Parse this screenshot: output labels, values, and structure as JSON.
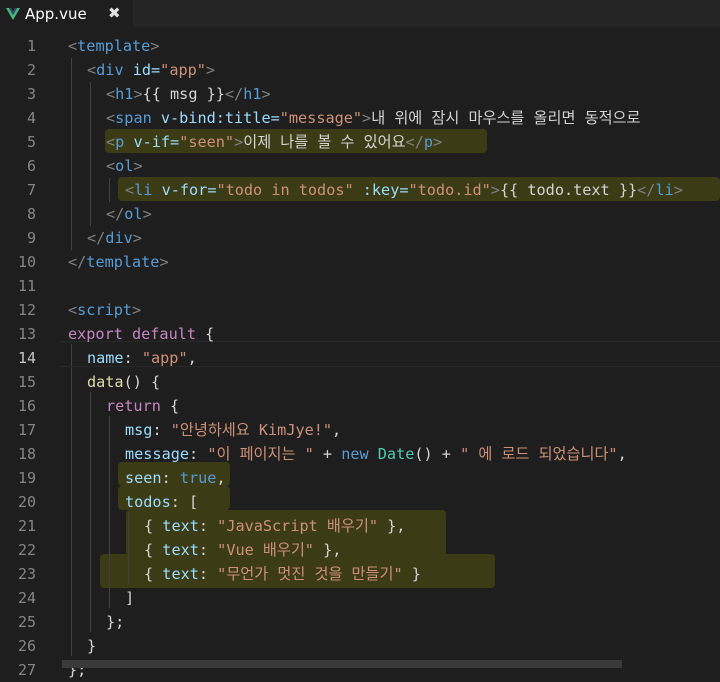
{
  "tab": {
    "title": "App.vue",
    "close_glyph": "✖",
    "icon": "vue-logo-icon"
  },
  "colors": {
    "tag": "#569cd6",
    "attr": "#9cdcfe",
    "string": "#ce9178",
    "keyword": "#c586c0",
    "function": "#dcdcaa",
    "class": "#4ec9b0",
    "highlight": "#3b3b15"
  },
  "editor": {
    "active_line": 14,
    "lines": [
      {
        "num": "1",
        "tokens": {
          "a": "<",
          "b": "template",
          "c": ">"
        }
      },
      {
        "num": "2",
        "tokens": {
          "a": "<",
          "b": "div",
          "c": " id=",
          "d": "\"app\"",
          "e": ">"
        }
      },
      {
        "num": "3",
        "tokens": {
          "a": "<",
          "b": "h1",
          "c": ">",
          "d": "{{ msg }}",
          "e": "</",
          "f": "h1",
          "g": ">"
        }
      },
      {
        "num": "4",
        "tokens": {
          "a": "<",
          "b": "span",
          "c": " v-bind:title=",
          "d": "\"message\"",
          "e": ">",
          "f": "내 위에 잠시 마우스를 올리면 동적으로"
        }
      },
      {
        "num": "5",
        "tokens": {
          "a": "<",
          "b": "p",
          "c": " v-if=",
          "d": "\"seen\"",
          "e": ">",
          "f": "이제 나를 볼 수 있어요",
          "g": "</",
          "h": "p",
          "i": ">"
        }
      },
      {
        "num": "6",
        "tokens": {
          "a": "<",
          "b": "ol",
          "c": ">"
        }
      },
      {
        "num": "7",
        "tokens": {
          "a": "<",
          "b": "li",
          "c": " v-for=",
          "d": "\"todo in todos\"",
          "e": " :key=",
          "f": "\"todo.id\"",
          "g": ">",
          "h": "{{ todo.text }}",
          "i": "</",
          "j": "li",
          "k": ">"
        }
      },
      {
        "num": "8",
        "tokens": {
          "a": "</",
          "b": "ol",
          "c": ">"
        }
      },
      {
        "num": "9",
        "tokens": {
          "a": "</",
          "b": "div",
          "c": ">"
        }
      },
      {
        "num": "10",
        "tokens": {
          "a": "</",
          "b": "template",
          "c": ">"
        }
      },
      {
        "num": "11",
        "tokens": {}
      },
      {
        "num": "12",
        "tokens": {
          "a": "<",
          "b": "script",
          "c": ">"
        }
      },
      {
        "num": "13",
        "tokens": {
          "a": "export default",
          "b": " {"
        }
      },
      {
        "num": "14",
        "tokens": {
          "a": "name",
          "b": ": ",
          "c": "\"app\"",
          "d": ","
        }
      },
      {
        "num": "15",
        "tokens": {
          "a": "data",
          "b": "() {"
        }
      },
      {
        "num": "16",
        "tokens": {
          "a": "return",
          "b": " {"
        }
      },
      {
        "num": "17",
        "tokens": {
          "a": "msg",
          "b": ": ",
          "c": "\"안녕하세요 KimJye!\"",
          "d": ","
        }
      },
      {
        "num": "18",
        "tokens": {
          "a": "message",
          "b": ": ",
          "c": "\"이 페이지는 \"",
          "d": " + ",
          "e": "new",
          "f": " ",
          "g": "Date",
          "h": "() + ",
          "i": "\" 에 로드 되었습니다\"",
          "j": ","
        }
      },
      {
        "num": "19",
        "tokens": {
          "a": "seen",
          "b": ": ",
          "c": "true",
          "d": ","
        }
      },
      {
        "num": "20",
        "tokens": {
          "a": "todos",
          "b": ": ["
        }
      },
      {
        "num": "21",
        "tokens": {
          "a": "{ ",
          "b": "text",
          "c": ": ",
          "d": "\"JavaScript 배우기\"",
          "e": " },"
        }
      },
      {
        "num": "22",
        "tokens": {
          "a": "{ ",
          "b": "text",
          "c": ": ",
          "d": "\"Vue 배우기\"",
          "e": " },"
        }
      },
      {
        "num": "23",
        "tokens": {
          "a": "{ ",
          "b": "text",
          "c": ": ",
          "d": "\"무언가 멋진 것을 만들기\"",
          "e": " }"
        }
      },
      {
        "num": "24",
        "tokens": {
          "a": "]"
        }
      },
      {
        "num": "25",
        "tokens": {
          "a": "};"
        }
      },
      {
        "num": "26",
        "tokens": {
          "a": "}"
        }
      },
      {
        "num": "27",
        "tokens": {
          "a": "};"
        }
      }
    ]
  }
}
